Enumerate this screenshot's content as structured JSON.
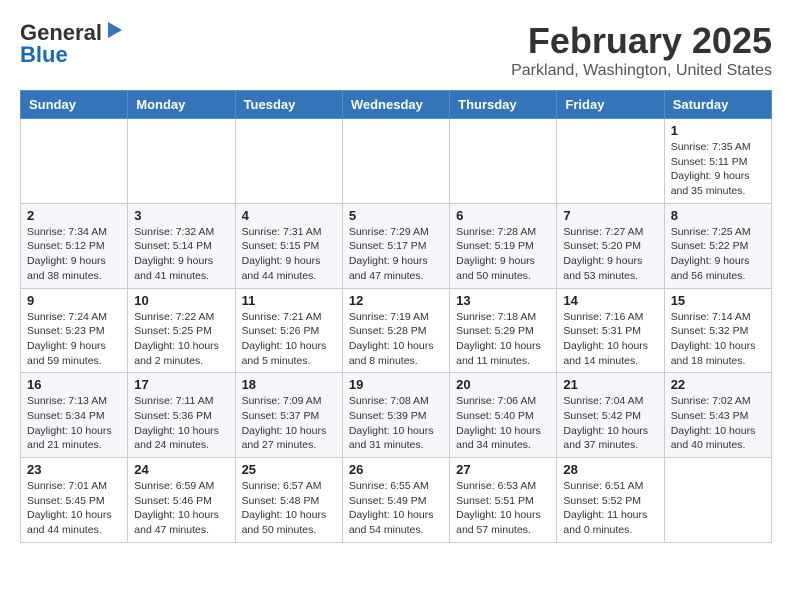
{
  "header": {
    "logo_general": "General",
    "logo_blue": "Blue",
    "title": "February 2025",
    "subtitle": "Parkland, Washington, United States"
  },
  "days_of_week": [
    "Sunday",
    "Monday",
    "Tuesday",
    "Wednesday",
    "Thursday",
    "Friday",
    "Saturday"
  ],
  "weeks": [
    [
      {
        "day": "",
        "info": ""
      },
      {
        "day": "",
        "info": ""
      },
      {
        "day": "",
        "info": ""
      },
      {
        "day": "",
        "info": ""
      },
      {
        "day": "",
        "info": ""
      },
      {
        "day": "",
        "info": ""
      },
      {
        "day": "1",
        "info": "Sunrise: 7:35 AM\nSunset: 5:11 PM\nDaylight: 9 hours and 35 minutes."
      }
    ],
    [
      {
        "day": "2",
        "info": "Sunrise: 7:34 AM\nSunset: 5:12 PM\nDaylight: 9 hours and 38 minutes."
      },
      {
        "day": "3",
        "info": "Sunrise: 7:32 AM\nSunset: 5:14 PM\nDaylight: 9 hours and 41 minutes."
      },
      {
        "day": "4",
        "info": "Sunrise: 7:31 AM\nSunset: 5:15 PM\nDaylight: 9 hours and 44 minutes."
      },
      {
        "day": "5",
        "info": "Sunrise: 7:29 AM\nSunset: 5:17 PM\nDaylight: 9 hours and 47 minutes."
      },
      {
        "day": "6",
        "info": "Sunrise: 7:28 AM\nSunset: 5:19 PM\nDaylight: 9 hours and 50 minutes."
      },
      {
        "day": "7",
        "info": "Sunrise: 7:27 AM\nSunset: 5:20 PM\nDaylight: 9 hours and 53 minutes."
      },
      {
        "day": "8",
        "info": "Sunrise: 7:25 AM\nSunset: 5:22 PM\nDaylight: 9 hours and 56 minutes."
      }
    ],
    [
      {
        "day": "9",
        "info": "Sunrise: 7:24 AM\nSunset: 5:23 PM\nDaylight: 9 hours and 59 minutes."
      },
      {
        "day": "10",
        "info": "Sunrise: 7:22 AM\nSunset: 5:25 PM\nDaylight: 10 hours and 2 minutes."
      },
      {
        "day": "11",
        "info": "Sunrise: 7:21 AM\nSunset: 5:26 PM\nDaylight: 10 hours and 5 minutes."
      },
      {
        "day": "12",
        "info": "Sunrise: 7:19 AM\nSunset: 5:28 PM\nDaylight: 10 hours and 8 minutes."
      },
      {
        "day": "13",
        "info": "Sunrise: 7:18 AM\nSunset: 5:29 PM\nDaylight: 10 hours and 11 minutes."
      },
      {
        "day": "14",
        "info": "Sunrise: 7:16 AM\nSunset: 5:31 PM\nDaylight: 10 hours and 14 minutes."
      },
      {
        "day": "15",
        "info": "Sunrise: 7:14 AM\nSunset: 5:32 PM\nDaylight: 10 hours and 18 minutes."
      }
    ],
    [
      {
        "day": "16",
        "info": "Sunrise: 7:13 AM\nSunset: 5:34 PM\nDaylight: 10 hours and 21 minutes."
      },
      {
        "day": "17",
        "info": "Sunrise: 7:11 AM\nSunset: 5:36 PM\nDaylight: 10 hours and 24 minutes."
      },
      {
        "day": "18",
        "info": "Sunrise: 7:09 AM\nSunset: 5:37 PM\nDaylight: 10 hours and 27 minutes."
      },
      {
        "day": "19",
        "info": "Sunrise: 7:08 AM\nSunset: 5:39 PM\nDaylight: 10 hours and 31 minutes."
      },
      {
        "day": "20",
        "info": "Sunrise: 7:06 AM\nSunset: 5:40 PM\nDaylight: 10 hours and 34 minutes."
      },
      {
        "day": "21",
        "info": "Sunrise: 7:04 AM\nSunset: 5:42 PM\nDaylight: 10 hours and 37 minutes."
      },
      {
        "day": "22",
        "info": "Sunrise: 7:02 AM\nSunset: 5:43 PM\nDaylight: 10 hours and 40 minutes."
      }
    ],
    [
      {
        "day": "23",
        "info": "Sunrise: 7:01 AM\nSunset: 5:45 PM\nDaylight: 10 hours and 44 minutes."
      },
      {
        "day": "24",
        "info": "Sunrise: 6:59 AM\nSunset: 5:46 PM\nDaylight: 10 hours and 47 minutes."
      },
      {
        "day": "25",
        "info": "Sunrise: 6:57 AM\nSunset: 5:48 PM\nDaylight: 10 hours and 50 minutes."
      },
      {
        "day": "26",
        "info": "Sunrise: 6:55 AM\nSunset: 5:49 PM\nDaylight: 10 hours and 54 minutes."
      },
      {
        "day": "27",
        "info": "Sunrise: 6:53 AM\nSunset: 5:51 PM\nDaylight: 10 hours and 57 minutes."
      },
      {
        "day": "28",
        "info": "Sunrise: 6:51 AM\nSunset: 5:52 PM\nDaylight: 11 hours and 0 minutes."
      },
      {
        "day": "",
        "info": ""
      }
    ]
  ]
}
